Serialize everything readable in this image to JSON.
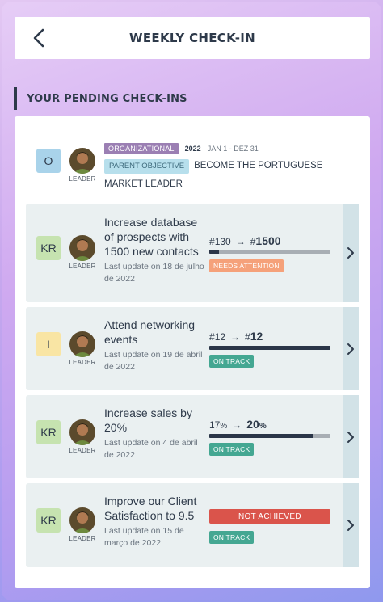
{
  "header": {
    "title": "WEEKLY CHECK-IN",
    "back_icon": "chevron-left-icon"
  },
  "section": {
    "title": "YOUR PENDING CHECK-INS"
  },
  "objective": {
    "badge": "O",
    "avatar_caption": "LEADER",
    "tag": "ORGANIZATIONAL",
    "year": "2022",
    "period": "JAN 1 - DEZ 31",
    "parent_tag": "PARENT OBJECTIVE",
    "title": "BECOME THE PORTUGUESE MARKET LEADER"
  },
  "colors": {
    "kr_badge": "#c6e3b0",
    "initiative_badge": "#f9e5a4",
    "objective_badge": "#a9d3ea",
    "needs_attention": "#f5a17a",
    "on_track": "#44a792",
    "not_achieved": "#da544b"
  },
  "cards": [
    {
      "badge": "KR",
      "avatar_caption": "LEADER",
      "title": "Increase database of prospects with 1500 new contacts",
      "update": "Last update on 18 de julho de 2022",
      "from": "130",
      "from_prefix": "#",
      "to": "1500",
      "to_prefix": "#",
      "progress": 0.08,
      "status": "NEEDS ATTENTION"
    },
    {
      "badge": "I",
      "avatar_caption": "LEADER",
      "title": "Attend networking events",
      "update": "Last update on 19 de abril de 2022",
      "from": "12",
      "from_prefix": "#",
      "to": "12",
      "to_prefix": "#",
      "progress": 1.0,
      "status": "ON TRACK"
    },
    {
      "badge": "KR",
      "avatar_caption": "LEADER",
      "title": "Increase sales by 20%",
      "update": "Last update on 4 de abril de 2022",
      "from": "17",
      "from_unit": "%",
      "to": "20",
      "to_unit": "%",
      "progress": 0.85,
      "status": "ON TRACK"
    },
    {
      "badge": "KR",
      "avatar_caption": "LEADER",
      "title": "Improve our Client Satisfaction to 9.5",
      "update": "Last update on 15 de março de 2022",
      "banner": "NOT ACHIEVED",
      "status": "ON TRACK"
    }
  ]
}
